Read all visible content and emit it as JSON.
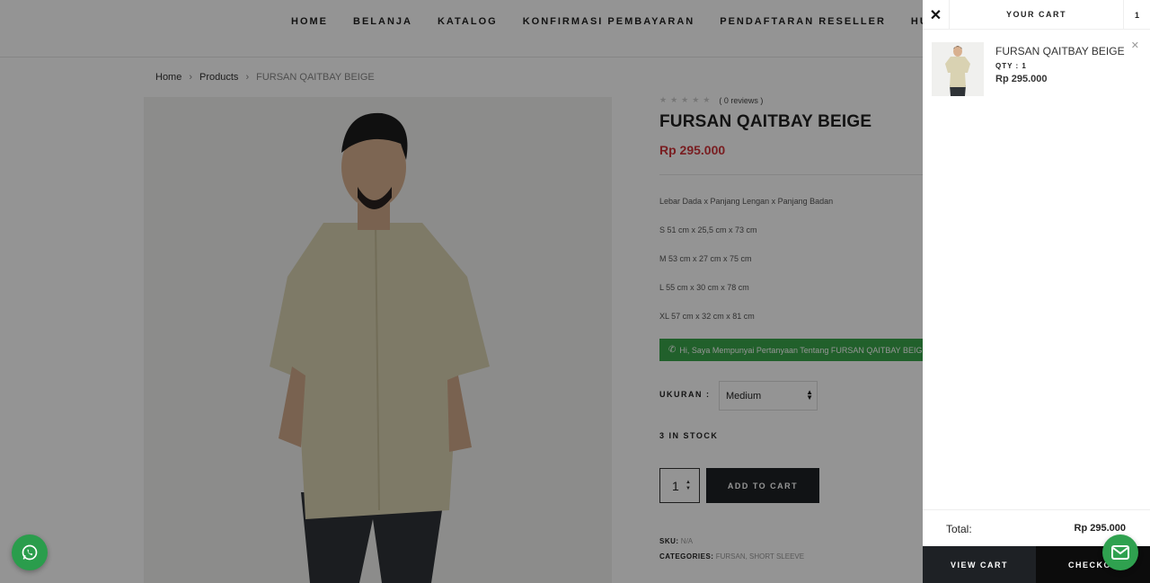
{
  "nav": {
    "items": [
      "HOME",
      "BELANJA",
      "KATALOG",
      "KONFIRMASI PEMBAYARAN",
      "PENDAFTARAN RESELLER",
      "HUBUNGI"
    ]
  },
  "breadcrumb": {
    "home": "Home",
    "products": "Products",
    "current": "FURSAN QAITBAY BEIGE"
  },
  "product": {
    "rating_stars": 0,
    "reviews_label": "( 0 reviews )",
    "title": "FURSAN QAITBAY BEIGE",
    "price": "Rp 295.000",
    "description": [
      "Lebar Dada x Panjang Lengan x Panjang Badan",
      "S    51 cm x 25,5 cm x 73 cm",
      "M  53 cm x 27 cm x 75 cm",
      "L    55 cm x 30 cm x 78 cm",
      "XL    57 cm x 32 cm x 81 cm"
    ],
    "whatsapp_button": "Hi, Saya Mempunyai Pertanyaan Tentang FURSAN QAITBAY BEIGE",
    "size_label": "UKURAN :",
    "size_value": "Medium",
    "stock": "3 IN STOCK",
    "quantity": "1",
    "add_to_cart": "ADD TO CART",
    "sku_label": "SKU:",
    "sku_value": "N/A",
    "categories_label": "CATEGORIES:",
    "categories_value": "FURSAN, SHORT SLEEVE"
  },
  "cart": {
    "title": "YOUR CART",
    "count": "1",
    "item": {
      "name": "FURSAN QAITBAY BEIGE",
      "qty": "QTY : 1",
      "price": "Rp 295.000"
    },
    "total_label": "Total:",
    "total_value": "Rp 295.000",
    "view_cart": "VIEW CART",
    "checkout": "CHECKOUT"
  },
  "colors": {
    "price_red": "#d0343a",
    "whatsapp_green": "#3aa64a",
    "button_dark": "#1e2125"
  },
  "icons": {
    "whatsapp": "whatsapp-icon",
    "mail": "mail-icon",
    "close": "close-icon",
    "remove": "remove-icon"
  }
}
